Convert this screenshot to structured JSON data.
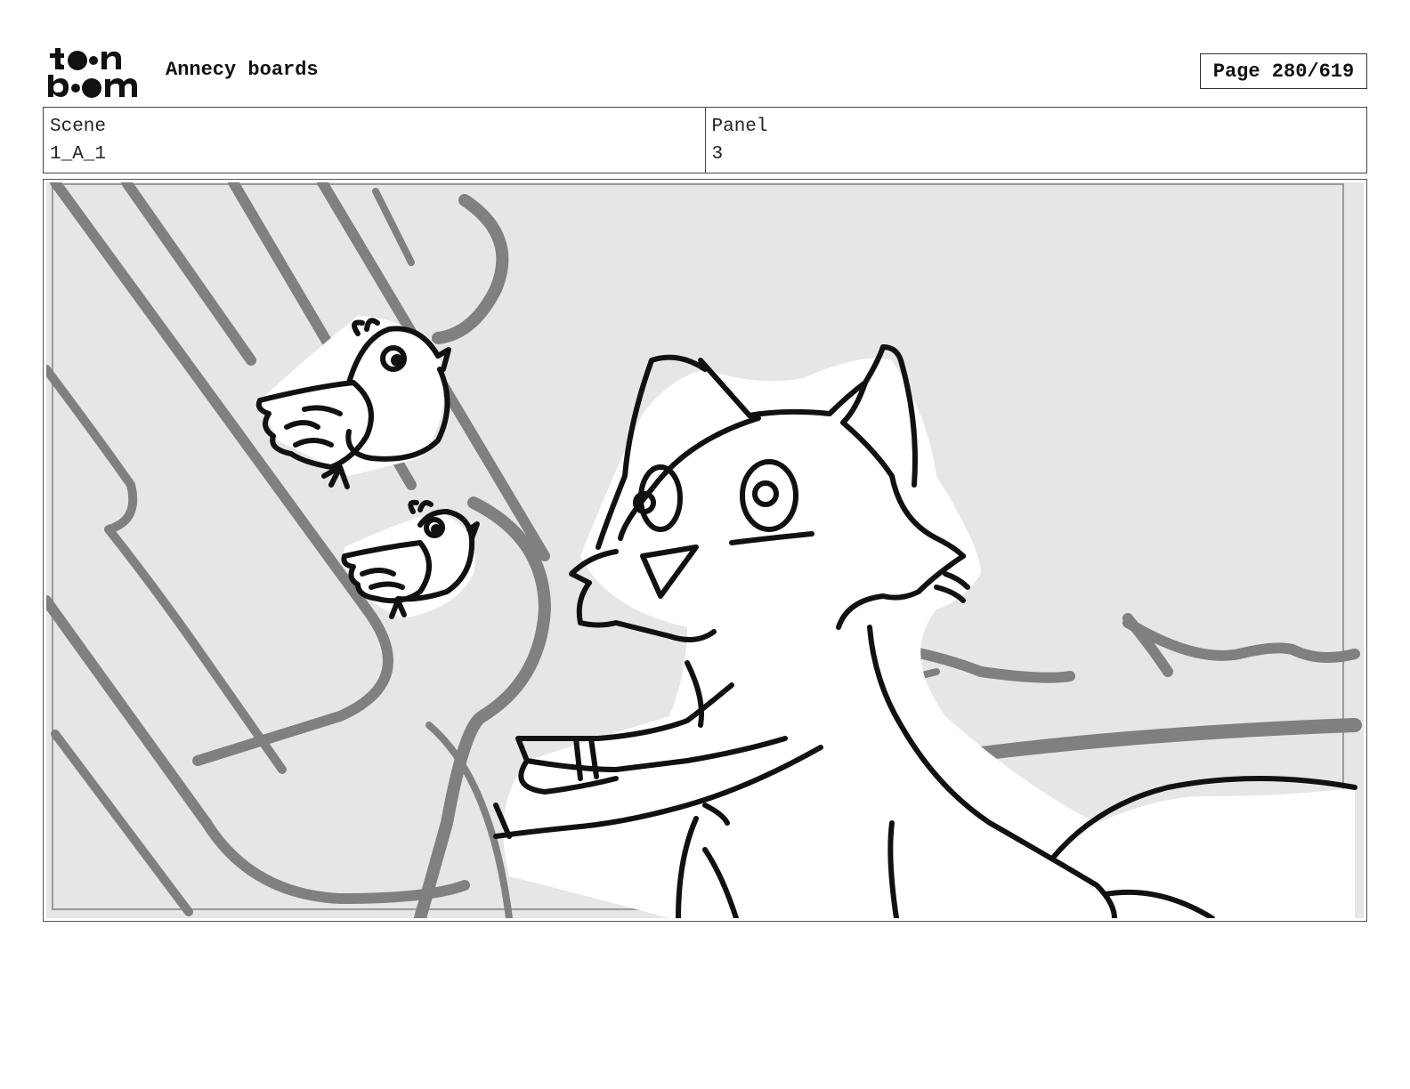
{
  "header": {
    "logo_line1": "to•n",
    "logo_line2": "b•om",
    "project_title": "Annecy boards",
    "page_indicator": "Page 280/619"
  },
  "info": {
    "scene_label": "Scene",
    "scene_value": "1_A_1",
    "panel_label": "Panel",
    "panel_value": "3"
  }
}
